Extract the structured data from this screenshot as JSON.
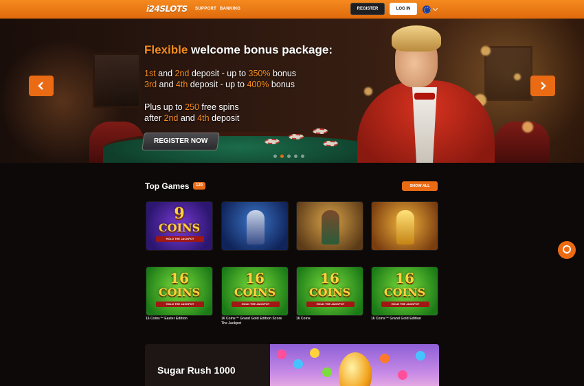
{
  "header": {
    "logo_text": "i24SLOTS",
    "nav": [
      {
        "label": "SUPPORT"
      },
      {
        "label": "BANKING"
      }
    ],
    "register_label": "REGISTER",
    "login_label": "LOG IN",
    "language_flag": "eu-flag-icon"
  },
  "hero": {
    "title_accent": "Flexible",
    "title_rest": "welcome bonus package:",
    "line1": {
      "a": "1st",
      "b": " and ",
      "c": "2nd",
      "d": " deposit - up to ",
      "e": "350%",
      "f": " bonus"
    },
    "line2": {
      "a": "3rd",
      "b": " and ",
      "c": "4th",
      "d": " deposit - up to ",
      "e": "400%",
      "f": " bonus"
    },
    "line3": {
      "a": "Plus up to ",
      "b": "250",
      "c": " free spins"
    },
    "line4": {
      "a": "after ",
      "b": "2nd",
      "c": " and ",
      "d": "4th",
      "e": " deposit"
    },
    "cta_label": "REGISTER NOW",
    "slides_count": 5,
    "active_slide": 1
  },
  "top_games": {
    "title": "Top Games",
    "count": "120",
    "show_all_label": "SHOW ALL",
    "row1": [
      {
        "art_title": "9",
        "art_sub": "COINS",
        "art_band": "HOLD THE JACKPOT"
      },
      {
        "art_title": "",
        "art_sub": "",
        "art_band": ""
      },
      {
        "art_title": "",
        "art_sub": "",
        "art_band": ""
      },
      {
        "art_title": "",
        "art_sub": "",
        "art_band": ""
      }
    ],
    "row2": [
      {
        "art_title": "16",
        "art_sub": "COINS",
        "art_band": "HOLD THE JACKPOT",
        "name": "16 Coins™ Easter Edition"
      },
      {
        "art_title": "16",
        "art_sub": "COINS",
        "art_band": "HOLD THE JACKPOT",
        "name": "16 Coins™ Grand Gold Edition Score The Jackpot"
      },
      {
        "art_title": "16",
        "art_sub": "COINS",
        "art_band": "HOLD THE JACKPOT",
        "name": "16 Coins"
      },
      {
        "art_title": "16",
        "art_sub": "COINS",
        "art_band": "HOLD THE JACKPOT",
        "name": "16 Coins™ Grand Gold Edition"
      }
    ]
  },
  "promo": {
    "title": "Sugar Rush 1000"
  },
  "colors": {
    "brand_orange": "#ea6b14",
    "header_orange": "#f58a1f",
    "background": "#0d0908"
  }
}
